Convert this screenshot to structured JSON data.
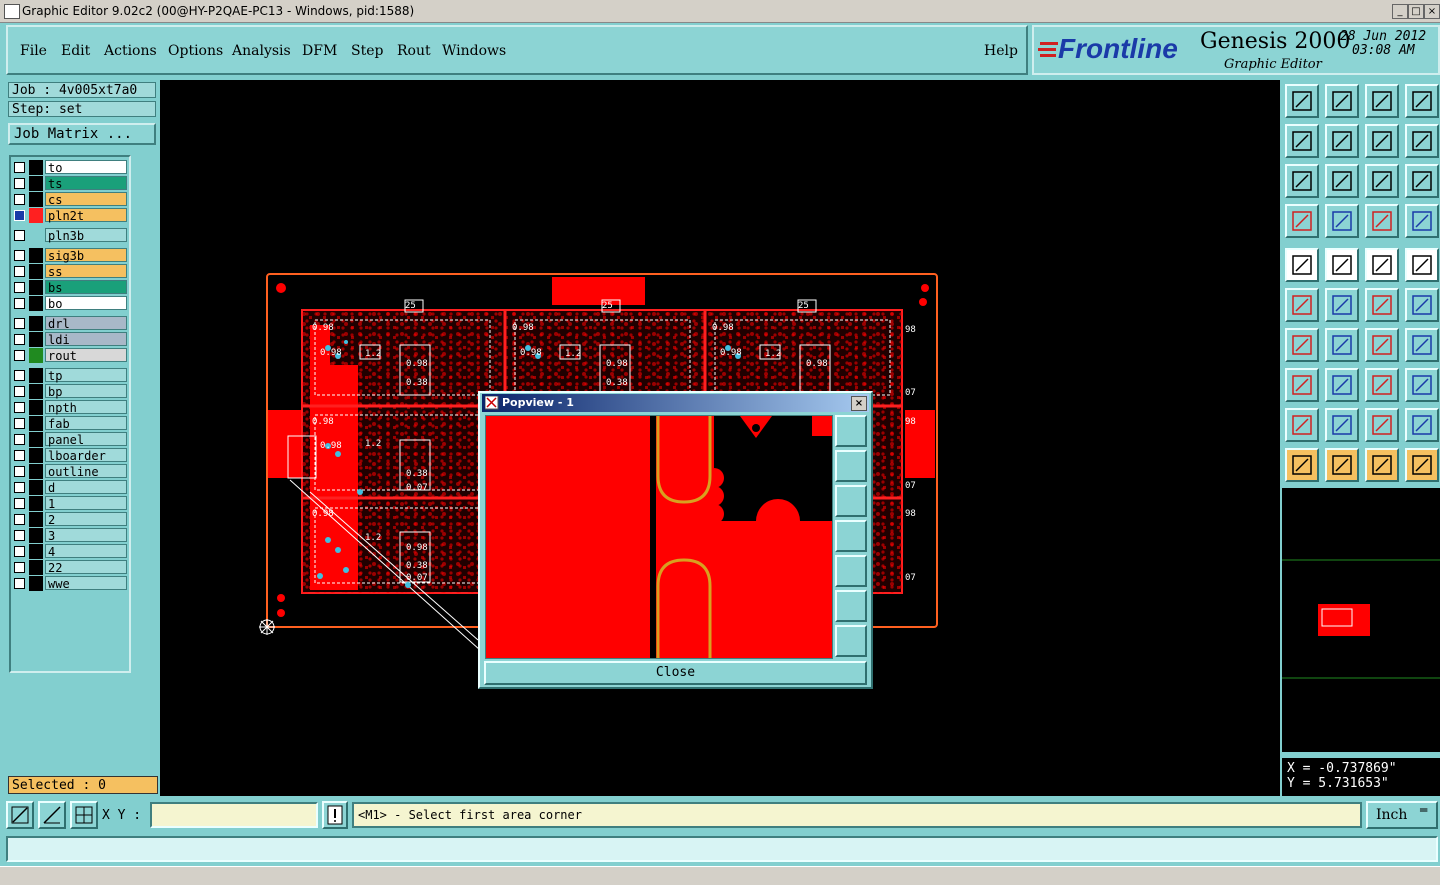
{
  "window": {
    "title": "Graphic Editor 9.02c2 (00@HY-P2QAE-PC13 - Windows, pid:1588)"
  },
  "menubar": {
    "items": [
      "File",
      "Edit",
      "Actions",
      "Options",
      "Analysis",
      "DFM",
      "Step",
      "Rout",
      "Windows"
    ],
    "help": "Help"
  },
  "brand": {
    "logo": "Frontline",
    "product": "Genesis 2000",
    "subtitle": "Graphic Editor",
    "date": "28 Jun 2012",
    "time": "03:08 AM"
  },
  "job": {
    "job_label": "Job : 4v005xt7a0",
    "step_label": "Step: set",
    "matrix_button": "Job Matrix ..."
  },
  "layers": [
    {
      "name": "to",
      "color": "#ffffff",
      "swatch": "#000000",
      "active": false
    },
    {
      "name": "ts",
      "color": "#1aa07a",
      "swatch": "#000000",
      "active": false
    },
    {
      "name": "cs",
      "color": "#f5c060",
      "swatch": "#000000",
      "active": false
    },
    {
      "name": "pln2t",
      "color": "#f5c060",
      "swatch": "#ff2020",
      "active": true
    },
    {
      "name": "pln3b",
      "color": "#a0dada",
      "swatch": "#82cfcf",
      "active": false
    },
    {
      "name": "sig3b",
      "color": "#f5c060",
      "swatch": "#000000",
      "active": false
    },
    {
      "name": "ss",
      "color": "#f5c060",
      "swatch": "#000000",
      "active": false
    },
    {
      "name": "bs",
      "color": "#1aa07a",
      "swatch": "#000000",
      "active": false
    },
    {
      "name": "bo",
      "color": "#ffffff",
      "swatch": "#000000",
      "active": false
    },
    {
      "name": "drl",
      "color": "#a8b8c8",
      "swatch": "#000000",
      "active": false
    },
    {
      "name": "ldi",
      "color": "#a8b8c8",
      "swatch": "#000000",
      "active": false
    },
    {
      "name": "rout",
      "color": "#d8d8d8",
      "swatch": "#208a20",
      "active": false
    },
    {
      "name": "tp",
      "color": "#a0dada",
      "swatch": "#000000",
      "active": false
    },
    {
      "name": "bp",
      "color": "#a0dada",
      "swatch": "#000000",
      "active": false
    },
    {
      "name": "npth",
      "color": "#a0dada",
      "swatch": "#000000",
      "active": false
    },
    {
      "name": "fab",
      "color": "#a0dada",
      "swatch": "#000000",
      "active": false
    },
    {
      "name": "panel",
      "color": "#a0dada",
      "swatch": "#000000",
      "active": false
    },
    {
      "name": "lboarder",
      "color": "#a0dada",
      "swatch": "#000000",
      "active": false
    },
    {
      "name": "outline",
      "color": "#a0dada",
      "swatch": "#000000",
      "active": false
    },
    {
      "name": "d",
      "color": "#a0dada",
      "swatch": "#000000",
      "active": false
    },
    {
      "name": "1",
      "color": "#a0dada",
      "swatch": "#000000",
      "active": false
    },
    {
      "name": "2",
      "color": "#a0dada",
      "swatch": "#000000",
      "active": false
    },
    {
      "name": "3",
      "color": "#a0dada",
      "swatch": "#000000",
      "active": false
    },
    {
      "name": "4",
      "color": "#a0dada",
      "swatch": "#000000",
      "active": false
    },
    {
      "name": "22",
      "color": "#a0dada",
      "swatch": "#000000",
      "active": false
    },
    {
      "name": "wwe",
      "color": "#a0dada",
      "swatch": "#000000",
      "active": false
    }
  ],
  "selected": "Selected : 0",
  "popview": {
    "title": "Popview - 1",
    "close_label": "Close"
  },
  "coords": {
    "x": "X = -0.737869\"",
    "y": "Y = 5.731653\""
  },
  "bottom": {
    "xy_label": "X Y :",
    "xy_value": "",
    "message": "<M1> - Select first area corner",
    "unit": "Inch"
  },
  "canvas_labels": [
    "0.98",
    "1.2",
    "0.38",
    "0.07",
    "98",
    "07",
    "25"
  ],
  "colors": {
    "panel": "#82cfcf",
    "copper": "#ff0000",
    "outline": "#ff6020",
    "drill": "#40c0e0",
    "accent": "#f5c060"
  }
}
